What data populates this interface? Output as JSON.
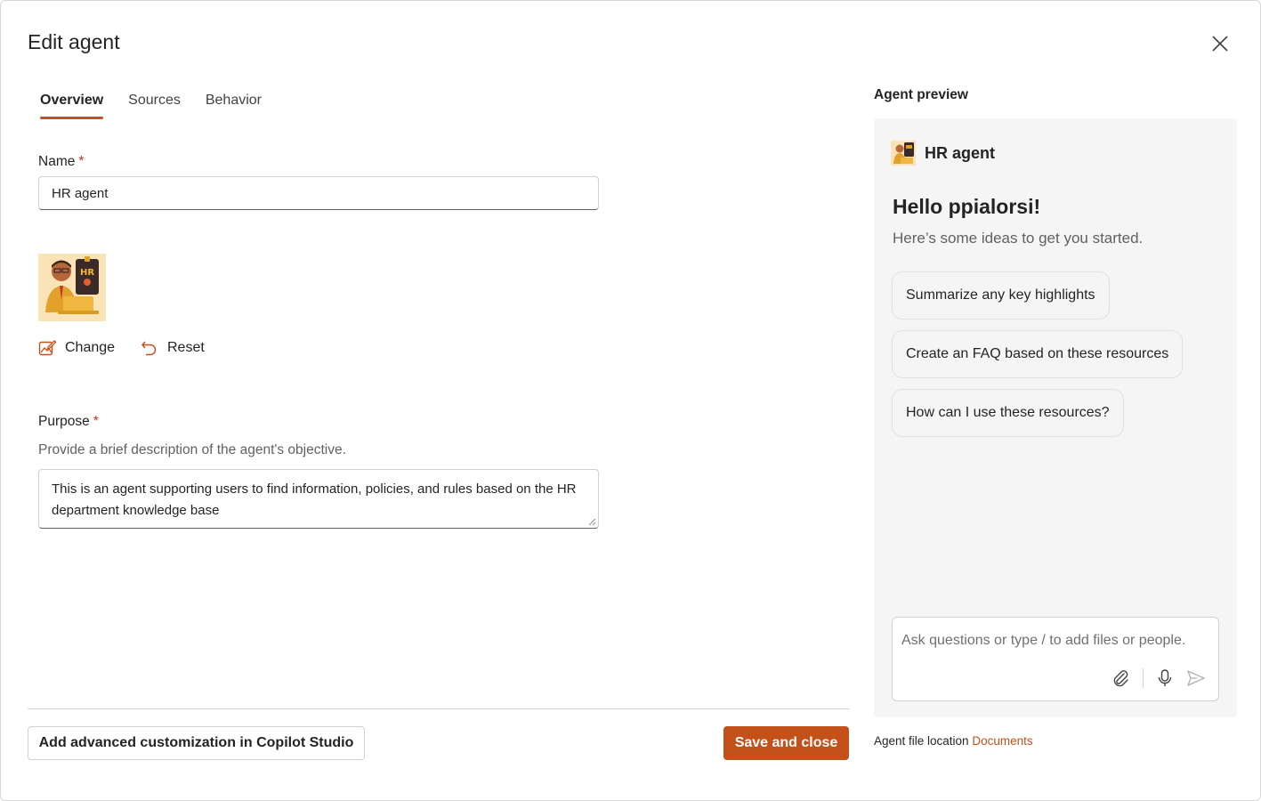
{
  "dialog": {
    "title": "Edit agent",
    "close_icon": "close-icon"
  },
  "tabs": [
    {
      "label": "Overview",
      "active": true
    },
    {
      "label": "Sources",
      "active": false
    },
    {
      "label": "Behavior",
      "active": false
    }
  ],
  "form": {
    "name_label": "Name",
    "required_mark": "*",
    "name_value": "HR agent",
    "change_label": "Change",
    "reset_label": "Reset",
    "purpose_label": "Purpose",
    "purpose_helper": "Provide a brief description of the agent's objective.",
    "purpose_value": "This is an agent supporting users to find information, policies, and rules based on the HR department knowledge base"
  },
  "footer": {
    "advanced_button": "Add advanced customization in Copilot Studio",
    "save_button": "Save and close"
  },
  "preview": {
    "title": "Agent preview",
    "agent_name": "HR agent",
    "greeting": "Hello ppialorsi!",
    "ideas_text": "Here’s some ideas to get you started.",
    "suggestions": [
      "Summarize any key highlights",
      "Create an FAQ based on these resources",
      "How can I use these resources?"
    ],
    "chat_placeholder": "Ask questions or type / to add files or people.",
    "file_location_label": "Agent file location",
    "file_location_link": "Documents"
  },
  "colors": {
    "accent": "#c4501a",
    "preview_bg": "#f5f5f5"
  }
}
